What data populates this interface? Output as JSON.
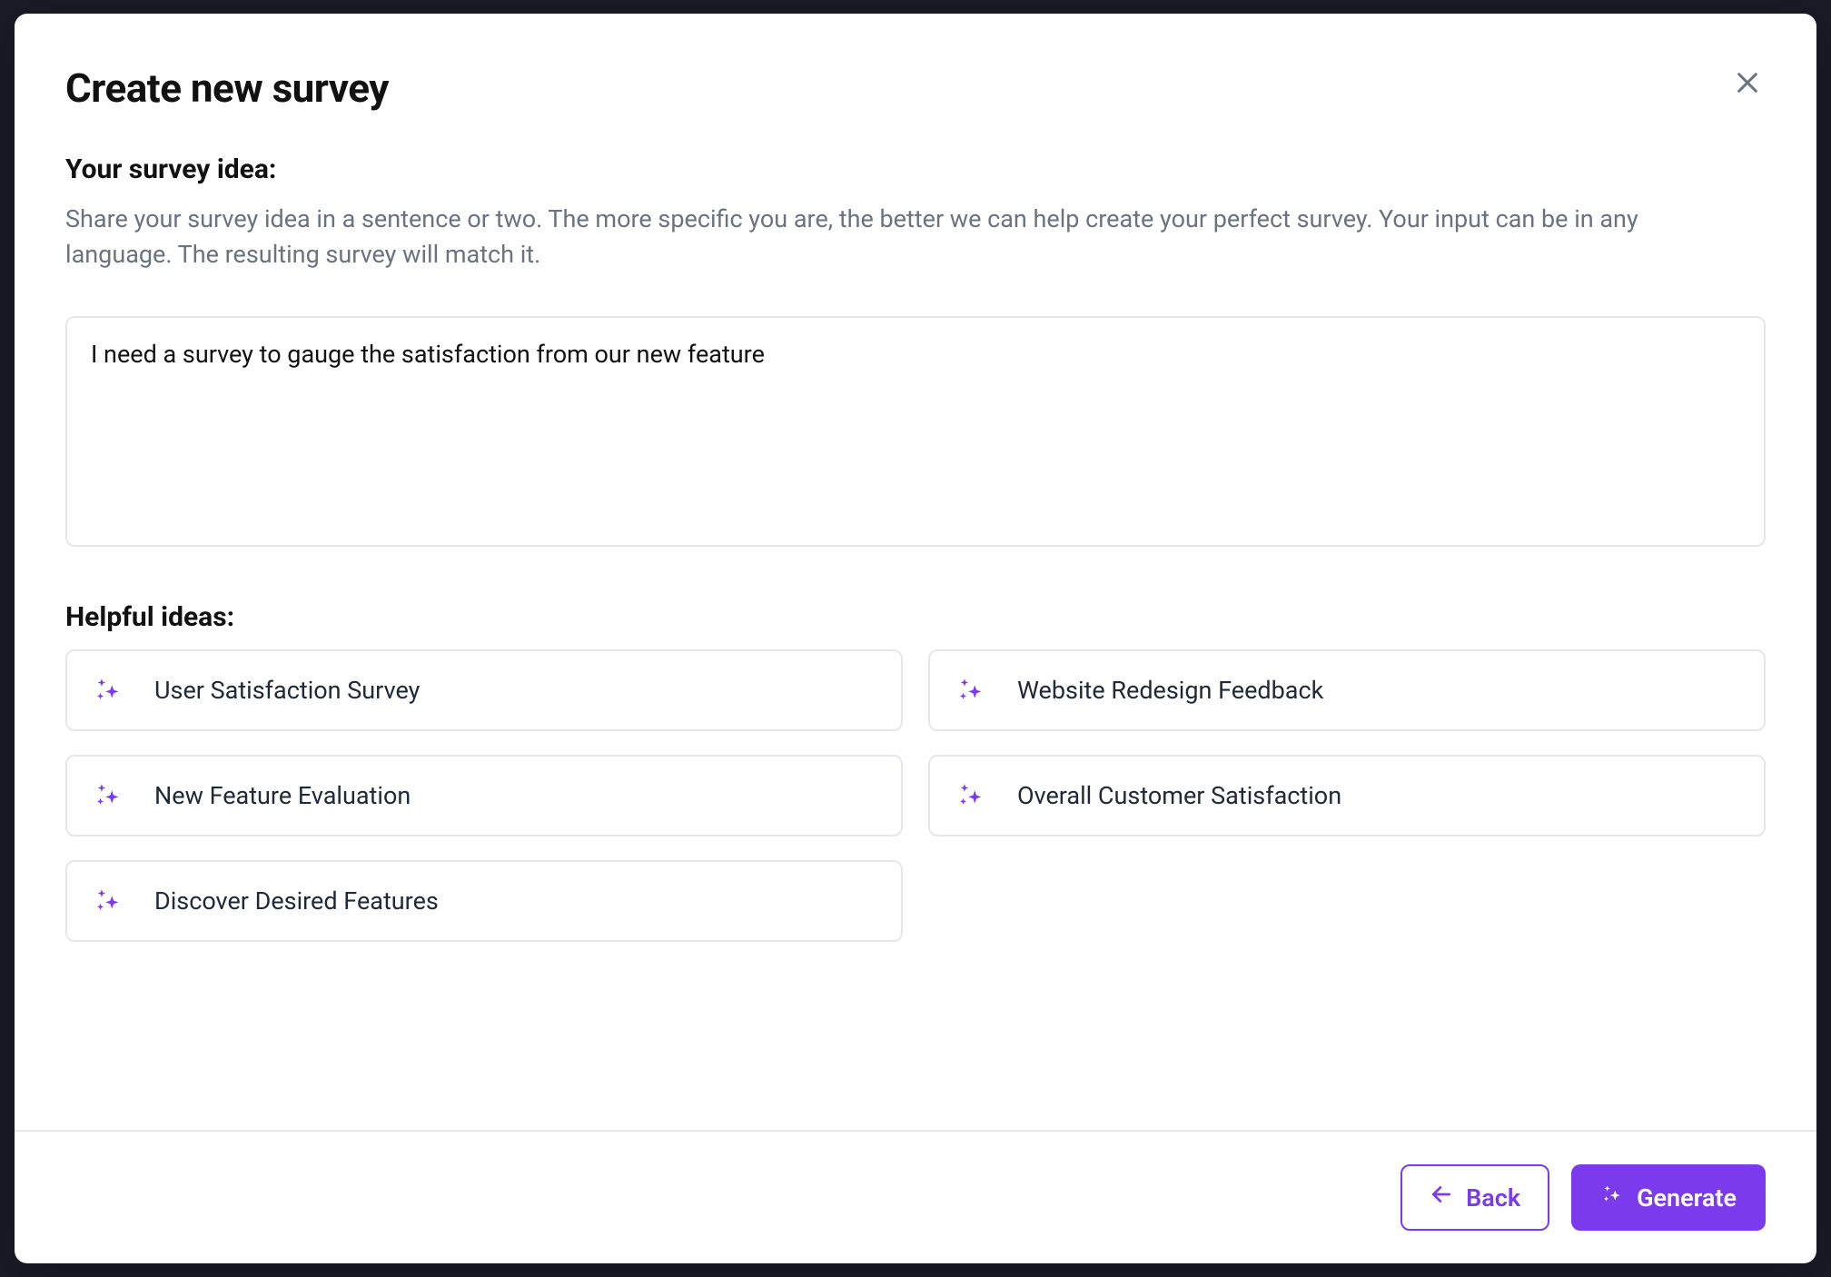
{
  "header": {
    "title": "Create new survey"
  },
  "intro": {
    "label": "Your survey idea:",
    "description": "Share your survey idea in a sentence or two. The more specific you are, the better we can help create your perfect survey. Your input can be in any language. The resulting survey will match it."
  },
  "textarea": {
    "value": "I need a survey to gauge the satisfaction from our new feature"
  },
  "helpful": {
    "label": "Helpful ideas:",
    "items": [
      {
        "label": "User Satisfaction Survey"
      },
      {
        "label": "Website Redesign Feedback"
      },
      {
        "label": "New Feature Evaluation"
      },
      {
        "label": "Overall Customer Satisfaction"
      },
      {
        "label": "Discover Desired Features"
      }
    ]
  },
  "footer": {
    "back_label": "Back",
    "generate_label": "Generate"
  },
  "colors": {
    "accent": "#7c3aed"
  }
}
